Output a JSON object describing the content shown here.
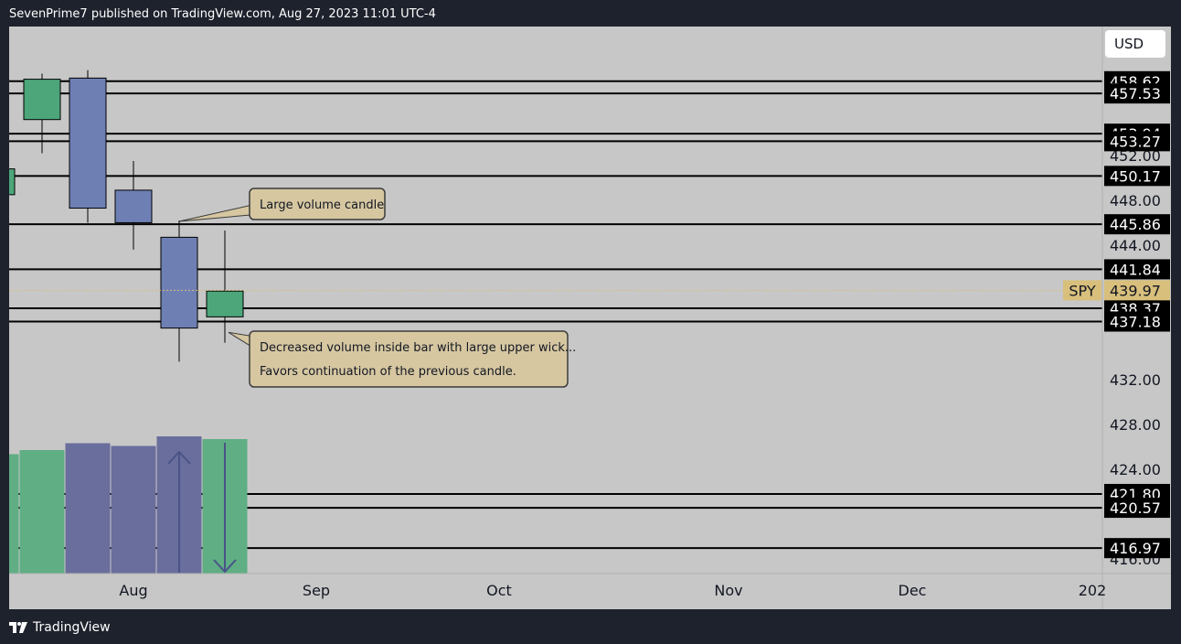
{
  "header": {
    "publish_text": "SevenPrime7 published on TradingView.com, Aug 27, 2023 11:01 UTC-4"
  },
  "footer": {
    "brand": "TradingView",
    "icon": "tradingview-logo-icon"
  },
  "toolbar": {
    "currency_label": "USD"
  },
  "colors": {
    "background": "#c7c7c7",
    "frame": "#1e222d",
    "bull": "#4ca67a",
    "bear": "#6e7fb4",
    "bull_volume": "#5fae84",
    "bear_volume": "#6a6e9c",
    "level_line": "#000000",
    "price_tag": "#000000",
    "symbol_tag": "#d8bf7c",
    "callout": "#d6c7a1"
  },
  "chart_data": {
    "type": "candlestick",
    "symbol": "SPY",
    "last_price": 439.97,
    "price_axis": {
      "ticks": [
        "452.00",
        "448.00",
        "444.00",
        "432.00",
        "428.00",
        "424.00",
        "416.00"
      ],
      "range": [
        414.7,
        463.5
      ]
    },
    "time_axis": {
      "labels": [
        "Aug",
        "Sep",
        "Oct",
        "Nov",
        "Dec",
        "202"
      ]
    },
    "horizontal_levels": [
      {
        "price": 458.62,
        "label": "458.62"
      },
      {
        "price": 457.53,
        "label": "457.53"
      },
      {
        "price": 453.94,
        "label": "453.94"
      },
      {
        "price": 453.27,
        "label": "453.27"
      },
      {
        "price": 450.17,
        "label": "450.17"
      },
      {
        "price": 445.86,
        "label": "445.86"
      },
      {
        "price": 441.84,
        "label": "441.84"
      },
      {
        "price": 438.37,
        "label": "438.37"
      },
      {
        "price": 437.18,
        "label": "437.18"
      },
      {
        "price": 421.8,
        "label": "421.80"
      },
      {
        "price": 420.57,
        "label": "420.57"
      },
      {
        "price": 416.97,
        "label": "416.97"
      }
    ],
    "candles": [
      {
        "open": 448.5,
        "high": 451.0,
        "low": 447.3,
        "close": 450.8,
        "dir": "up"
      },
      {
        "open": 455.2,
        "high": 459.3,
        "low": 452.2,
        "close": 458.8,
        "dir": "up"
      },
      {
        "open": 458.9,
        "high": 459.6,
        "low": 446.0,
        "close": 447.3,
        "dir": "down"
      },
      {
        "open": 448.9,
        "high": 451.5,
        "low": 443.6,
        "close": 446.0,
        "dir": "down"
      },
      {
        "open": 444.7,
        "high": 446.2,
        "low": 433.6,
        "close": 436.6,
        "dir": "down"
      },
      {
        "open": 439.9,
        "high": 445.3,
        "low": 435.3,
        "close": 437.6,
        "dir": "up"
      }
    ],
    "volume": [
      {
        "value": 0.87,
        "dir": "up"
      },
      {
        "value": 0.9,
        "dir": "up"
      },
      {
        "value": 0.95,
        "dir": "down"
      },
      {
        "value": 0.93,
        "dir": "down"
      },
      {
        "value": 1.0,
        "dir": "down"
      },
      {
        "value": 0.98,
        "dir": "up"
      }
    ],
    "annotations": [
      {
        "text": "Large volume candle",
        "candle": 4
      },
      {
        "lines": [
          "Decreased volume inside bar with large upper wick...",
          "Favors continuation of the previous candle."
        ],
        "candle": 5
      }
    ]
  }
}
